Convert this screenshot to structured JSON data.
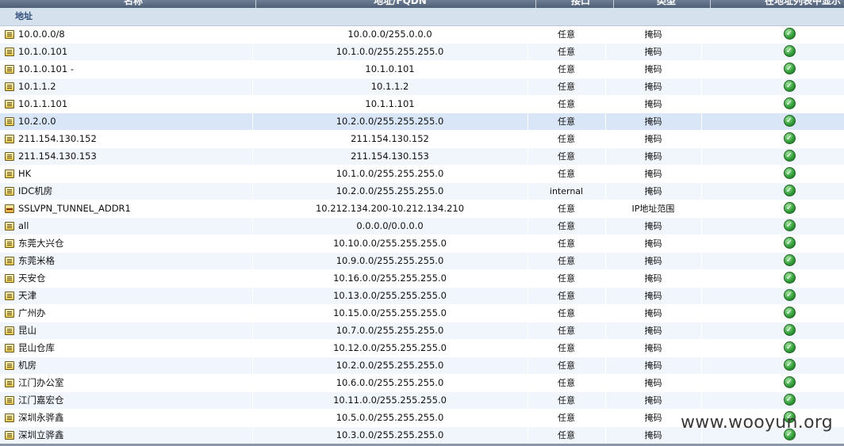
{
  "header": {
    "col_name": "名称",
    "col_address": "地址/FQDN",
    "col_interface": "接口",
    "col_type": "类型",
    "col_in_list": "在地址列表中显示"
  },
  "group": {
    "label": "地址"
  },
  "icons": {
    "address": "address-object-icon",
    "range": "address-range-icon",
    "check": "green-check-icon"
  },
  "rows": [
    {
      "name": "10.0.0.0/8",
      "address": "10.0.0.0/255.0.0.0",
      "interface": "任意",
      "type": "掩码"
    },
    {
      "name": "10.1.0.101",
      "address": "10.1.0.0/255.255.255.0",
      "interface": "任意",
      "type": "掩码"
    },
    {
      "name": "10.1.0.101 -",
      "address": "10.1.0.101",
      "interface": "任意",
      "type": "掩码"
    },
    {
      "name": "10.1.1.2",
      "address": "10.1.1.2",
      "interface": "任意",
      "type": "掩码"
    },
    {
      "name": "10.1.1.101",
      "address": "10.1.1.101",
      "interface": "任意",
      "type": "掩码"
    },
    {
      "name": "10.2.0.0",
      "address": "10.2.0.0/255.255.255.0",
      "interface": "任意",
      "type": "掩码"
    },
    {
      "name": "211.154.130.152",
      "address": "211.154.130.152",
      "interface": "任意",
      "type": "掩码"
    },
    {
      "name": "211.154.130.153",
      "address": "211.154.130.153",
      "interface": "任意",
      "type": "掩码"
    },
    {
      "name": "HK",
      "address": "10.1.0.0/255.255.255.0",
      "interface": "任意",
      "type": "掩码"
    },
    {
      "name": "IDC机房",
      "address": "10.2.0.0/255.255.255.0",
      "interface": "internal",
      "type": "掩码"
    },
    {
      "name": "SSLVPN_TUNNEL_ADDR1",
      "address": "10.212.134.200-10.212.134.210",
      "interface": "任意",
      "type": "IP地址范围"
    },
    {
      "name": "all",
      "address": "0.0.0.0/0.0.0.0",
      "interface": "任意",
      "type": "掩码"
    },
    {
      "name": "东莞大兴仓",
      "address": "10.10.0.0/255.255.255.0",
      "interface": "任意",
      "type": "掩码"
    },
    {
      "name": "东莞米格",
      "address": "10.9.0.0/255.255.255.0",
      "interface": "任意",
      "type": "掩码"
    },
    {
      "name": "天安仓",
      "address": "10.16.0.0/255.255.255.0",
      "interface": "任意",
      "type": "掩码"
    },
    {
      "name": "天津",
      "address": "10.13.0.0/255.255.255.0",
      "interface": "任意",
      "type": "掩码"
    },
    {
      "name": "广州办",
      "address": "10.15.0.0/255.255.255.0",
      "interface": "任意",
      "type": "掩码"
    },
    {
      "name": "昆山",
      "address": "10.7.0.0/255.255.255.0",
      "interface": "任意",
      "type": "掩码"
    },
    {
      "name": "昆山仓库",
      "address": "10.12.0.0/255.255.255.0",
      "interface": "任意",
      "type": "掩码"
    },
    {
      "name": "机房",
      "address": "10.2.0.0/255.255.255.0",
      "interface": "任意",
      "type": "掩码"
    },
    {
      "name": "江门办公室",
      "address": "10.6.0.0/255.255.255.0",
      "interface": "任意",
      "type": "掩码"
    },
    {
      "name": "江门嘉宏仓",
      "address": "10.11.0.0/255.255.255.0",
      "interface": "任意",
      "type": "掩码"
    },
    {
      "name": "深圳永骅鑫",
      "address": "10.5.0.0/255.255.255.0",
      "interface": "任意",
      "type": "掩码"
    },
    {
      "name": "深圳立骅鑫",
      "address": "10.3.0.0/255.255.255.0",
      "interface": "任意",
      "type": "掩码"
    }
  ],
  "watermark": "www.wooyun.org"
}
